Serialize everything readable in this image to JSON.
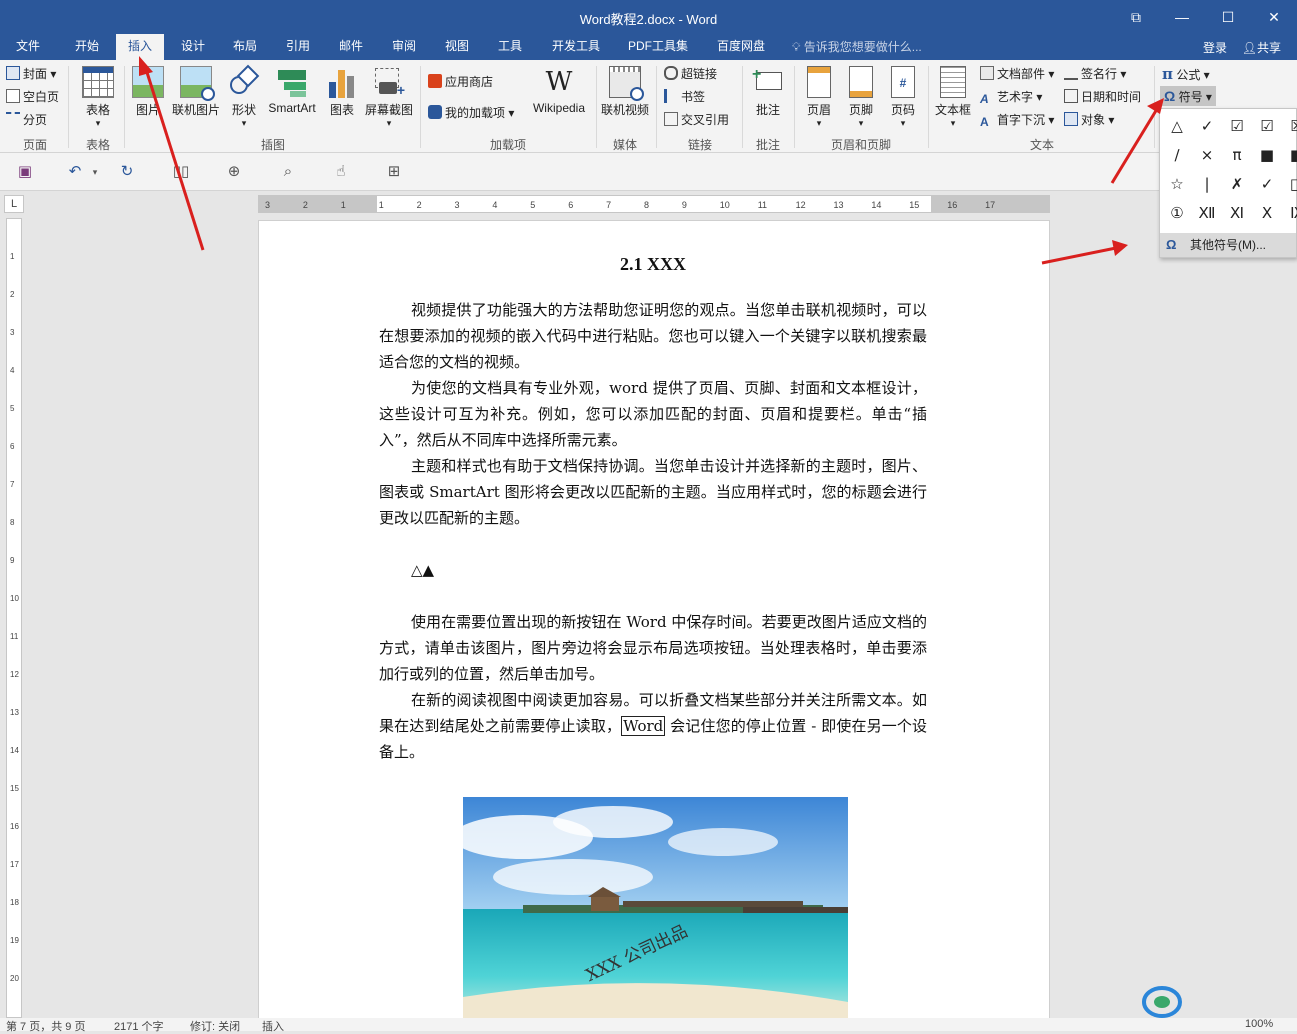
{
  "window": {
    "title": "Word教程2.docx - Word",
    "restore": "⧉",
    "minimize": "—",
    "maximize": "☐",
    "close": "✕"
  },
  "tabs": [
    "文件",
    "开始",
    "插入",
    "设计",
    "布局",
    "引用",
    "邮件",
    "审阅",
    "视图",
    "工具",
    "开发工具",
    "PDF工具集",
    "百度网盘"
  ],
  "active_tab": "插入",
  "tell_me": "告诉我您想要做什么...",
  "account": {
    "login": "登录",
    "share": "共享"
  },
  "ribbon": {
    "pages": {
      "cover": "封面",
      "blank": "空白页",
      "break": "分页",
      "label": "页面"
    },
    "tables": {
      "table": "表格",
      "label": "表格"
    },
    "illustrations": {
      "picture": "图片",
      "online_picture": "联机图片",
      "shapes": "形状",
      "smartart": "SmartArt",
      "chart": "图表",
      "screenshot": "屏幕截图",
      "label": "插图"
    },
    "addins": {
      "store": "应用商店",
      "my_addins": "我的加载项",
      "wikipedia": "Wikipedia",
      "label": "加载项"
    },
    "media": {
      "online_video": "联机视频",
      "label": "媒体"
    },
    "links": {
      "hyperlink": "超链接",
      "bookmark": "书签",
      "cross_ref": "交叉引用",
      "label": "链接"
    },
    "comments": {
      "comment": "批注",
      "label": "批注"
    },
    "header_footer": {
      "header": "页眉",
      "footer": "页脚",
      "page_number": "页码",
      "label": "页眉和页脚"
    },
    "text": {
      "text_box": "文本框",
      "quick_parts": "文档部件",
      "wordart": "艺术字",
      "dropcap": "首字下沉",
      "signature": "签名行",
      "datetime": "日期和时间",
      "object": "对象",
      "label": "文本"
    },
    "symbols": {
      "equation": "公式",
      "symbol": "符号"
    }
  },
  "symbol_dropdown": {
    "symbols": [
      "△",
      "✓",
      "☑",
      "☑",
      "☒",
      "∕",
      "×",
      "π",
      "■",
      "■",
      "☆",
      "|",
      "✗",
      "✓",
      "□",
      "①",
      "Ⅻ",
      "Ⅺ",
      "Ⅹ",
      "Ⅸ"
    ],
    "more_label": "其他符号(M)..."
  },
  "ruler": {
    "h_ticks": [
      "3",
      "2",
      "1",
      "1",
      "2",
      "3",
      "4",
      "5",
      "6",
      "7",
      "8",
      "9",
      "10",
      "11",
      "12",
      "13",
      "14",
      "15",
      "16",
      "17"
    ],
    "v_ticks": [
      "1",
      "2",
      "3",
      "4",
      "5",
      "6",
      "7",
      "8",
      "9",
      "10",
      "11",
      "12",
      "13",
      "14",
      "15",
      "16",
      "17",
      "18",
      "19",
      "20"
    ],
    "corner": "L"
  },
  "document": {
    "heading": "2.1 XXX",
    "p1": "视频提供了功能强大的方法帮助您证明您的观点。当您单击联机视频时，可以在想要添加的视频的嵌入代码中进行粘贴。您也可以键入一个关键字以联机搜索最适合您的文档的视频。",
    "p2": "为使您的文档具有专业外观，word 提供了页眉、页脚、封面和文本框设计，这些设计可互为补充。例如，您可以添加匹配的封面、页眉和提要栏。单击“插入”，然后从不同库中选择所需元素。",
    "p3": "主题和样式也有助于文档保持协调。当您单击设计并选择新的主题时，图片、图表或 SmartArt 图形将会更改以匹配新的主题。当应用样式时，您的标题会进行更改以匹配新的主题。",
    "symbols_line": "△▲",
    "p4": "使用在需要位置出现的新按钮在 Word 中保存时间。若要更改图片适应文档的方式，请单击该图片，图片旁边将会显示布局选项按钮。当处理表格时，单击要添加行或列的位置，然后单击加号。",
    "p5_a": "在新的阅读视图中阅读更加容易。可以折叠文档某些部分并关注所需文本。如果在达到结尾处之前需要停止读取，",
    "p5_word": "Word",
    "p5_b": " 会记住您的停止位置 - 即使在另一个设备上。",
    "image_watermark": "XXX 公司出品"
  },
  "status": {
    "page": "第 7 页，共 9 页",
    "words": "2171 个字",
    "track": "修订: 关闭",
    "insert": "插入",
    "zoom": "100%"
  },
  "colors": {
    "accent": "#2b579a",
    "arrow": "#d9201e"
  }
}
